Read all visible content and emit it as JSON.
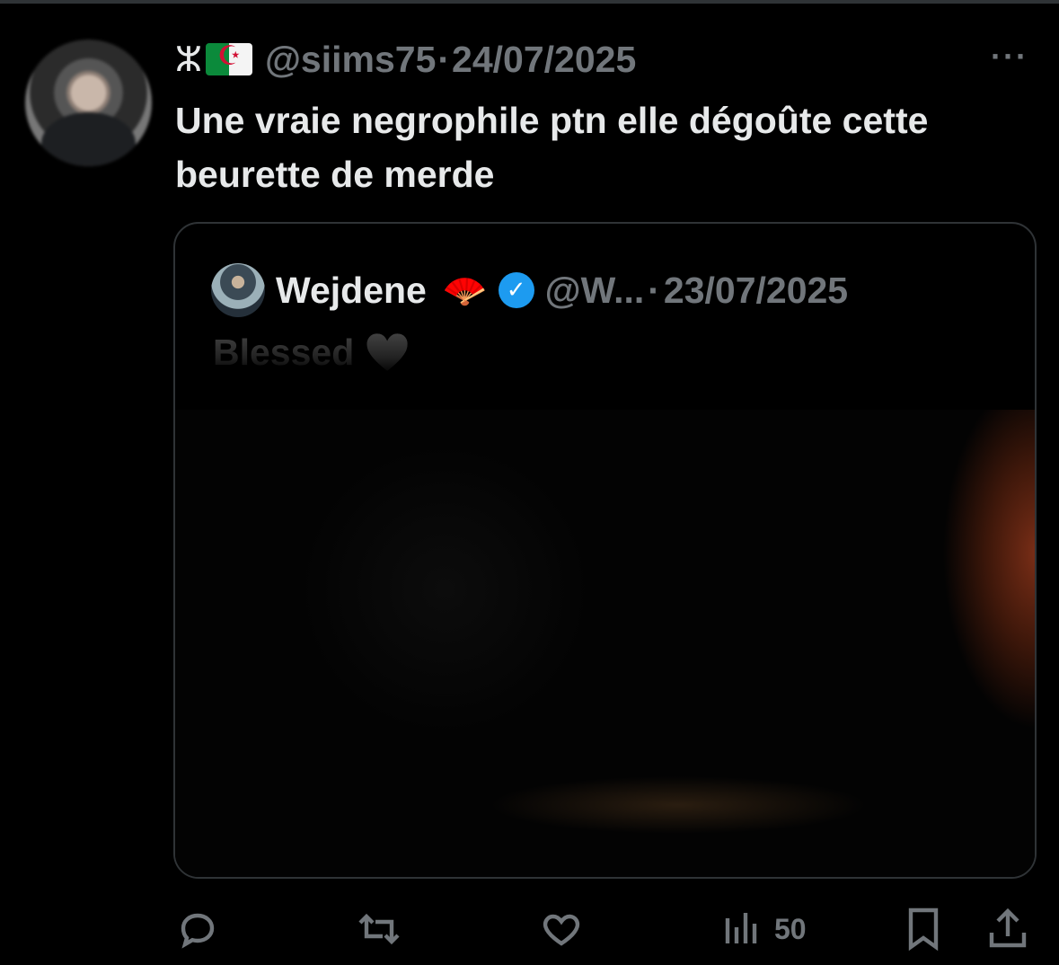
{
  "tweet": {
    "author_prefix": "ⵣ",
    "flag_icon": "algeria-flag-icon",
    "handle": "@siims75",
    "separator": "·",
    "date": "24/07/2025",
    "more_label": "···",
    "text": "Une vraie negrophile ptn elle dégoûte cette beurette de merde"
  },
  "quoted_tweet": {
    "display_name": "Wejdene",
    "name_emoji": "🪭",
    "verified_icon": "verified-badge-icon",
    "handle": "@W...",
    "separator": "·",
    "date": "23/07/2025",
    "text": "Blessed 🖤"
  },
  "actions": {
    "reply_icon": "reply-icon",
    "retweet_icon": "retweet-icon",
    "like_icon": "like-icon",
    "views_icon": "views-icon",
    "views_count": "50",
    "bookmark_icon": "bookmark-icon",
    "share_icon": "share-icon"
  },
  "colors": {
    "background": "#000000",
    "text": "#e7e9ea",
    "muted": "#71767b",
    "verified": "#1d9bf0",
    "border": "#2f3336"
  }
}
